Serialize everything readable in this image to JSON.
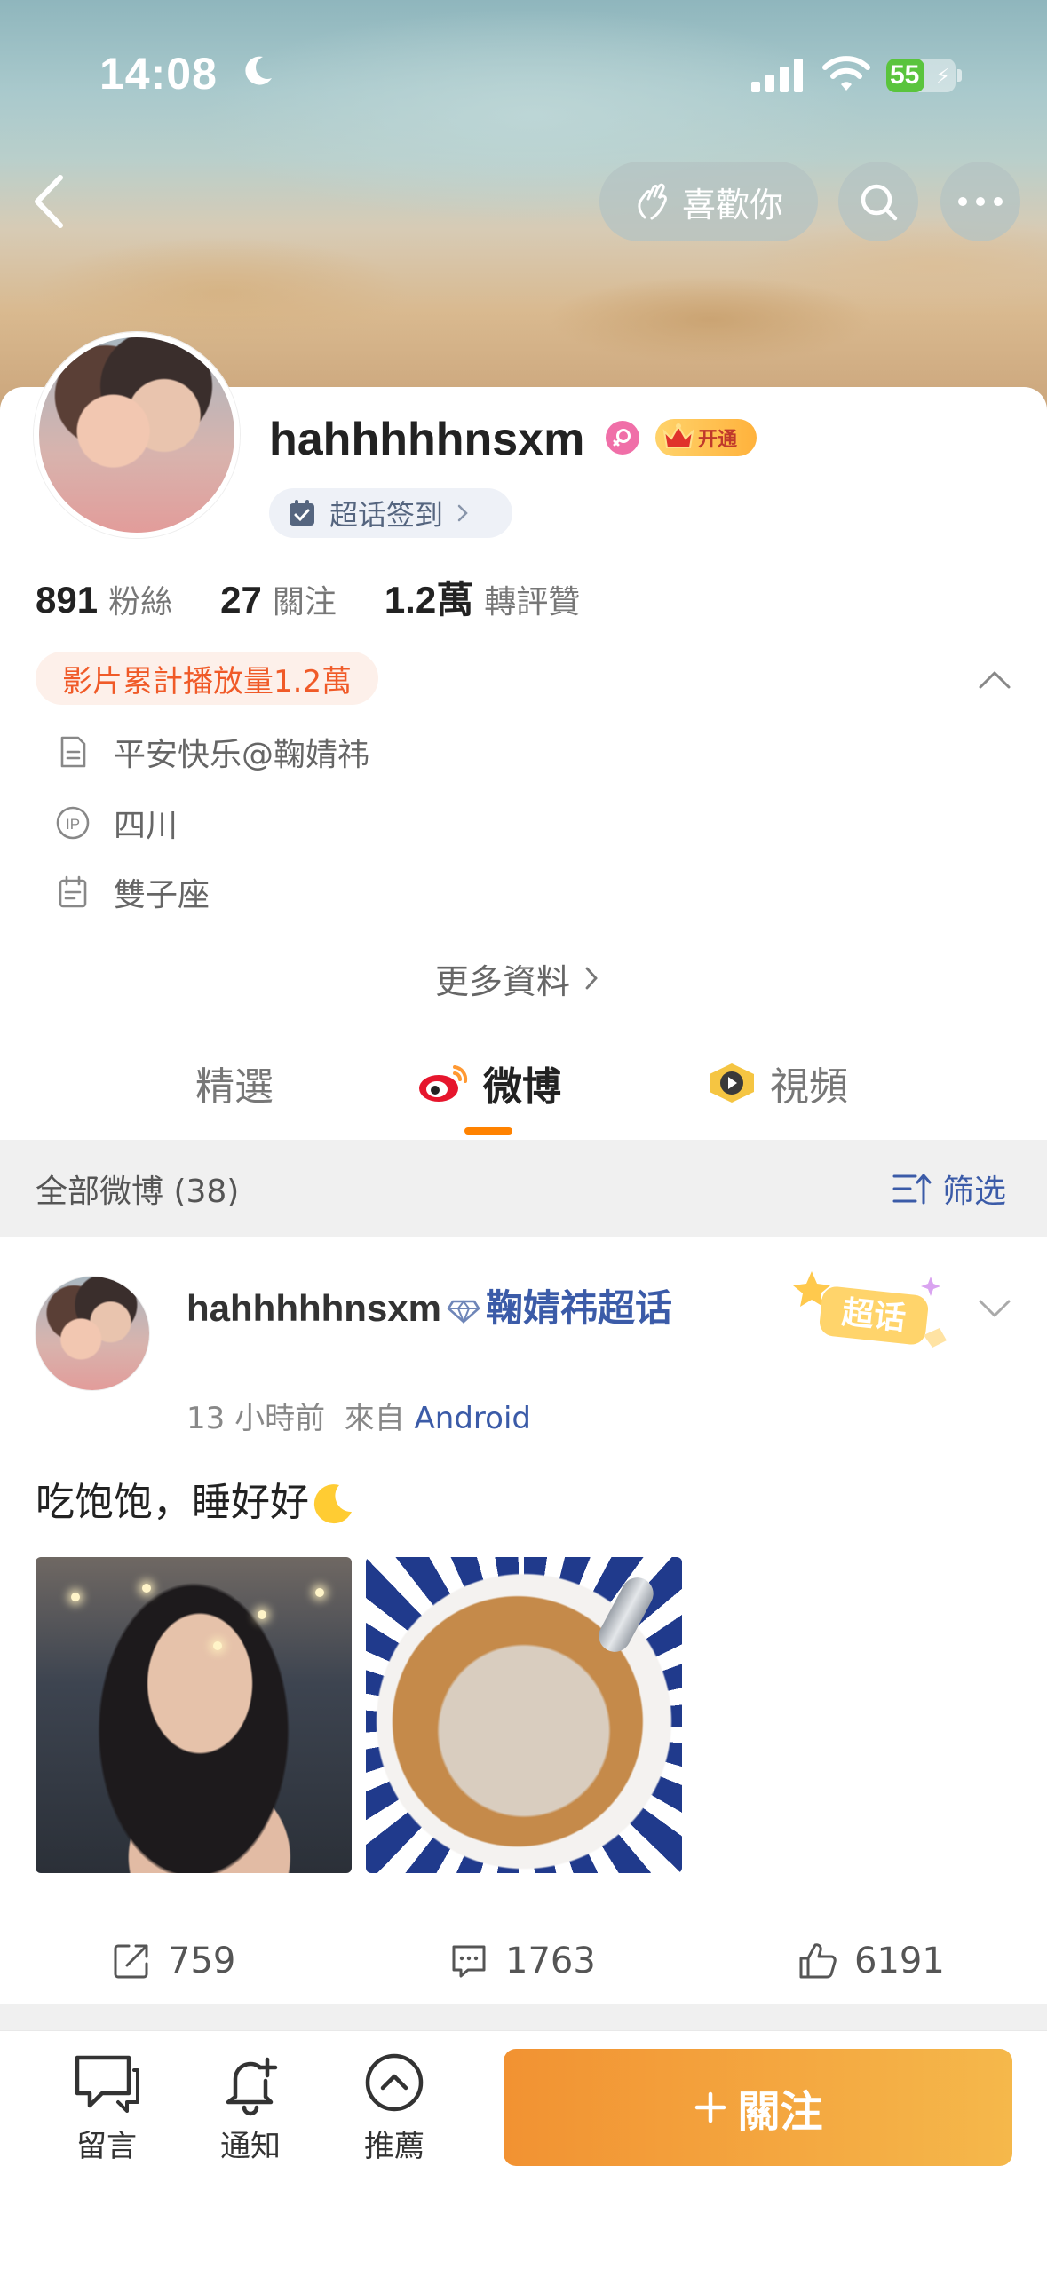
{
  "status_bar": {
    "time": "14:08",
    "battery": "55",
    "battery_level": 0.55
  },
  "header": {
    "like_button_label": "喜歡你"
  },
  "profile": {
    "username": "hahhhhhnsxm",
    "vip_badge": "开通",
    "checkin_label": "超话签到",
    "stats": [
      {
        "value": "891",
        "label": "粉絲"
      },
      {
        "value": "27",
        "label": "關注"
      },
      {
        "value": "1.2萬",
        "label": "轉評贊"
      }
    ],
    "video_plays": "影片累計播放量1.2萬",
    "bio": "平安快乐@鞠婧祎",
    "location": "四川",
    "zodiac": "雙子座",
    "more_info": "更多資料"
  },
  "tabs": [
    {
      "label": "精選"
    },
    {
      "label": "微博"
    },
    {
      "label": "視頻"
    }
  ],
  "filter_bar": {
    "count_label": "全部微博 (38)",
    "filter_label": "筛选"
  },
  "post": {
    "author": "hahhhhhnsxm",
    "topic": "鞠婧祎超话",
    "time": "13 小時前",
    "source_prefix": "來自",
    "source": "Android",
    "sticker_label": "超话",
    "text": "吃饱饱，睡好好",
    "reposts": "759",
    "comments": "1763",
    "likes": "6191"
  },
  "bottom_bar": {
    "comment_label": "留言",
    "notify_label": "通知",
    "recommend_label": "推薦",
    "follow_label": "關注"
  },
  "colors": {
    "accent": "#ff8200",
    "link": "#3b5ba8",
    "follow_gradient_start": "#f29232",
    "follow_gradient_end": "#f5b84b"
  }
}
